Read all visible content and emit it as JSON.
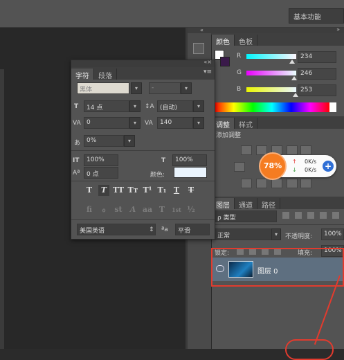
{
  "workspace": {
    "label": "基本功能"
  },
  "color_panel": {
    "tabs": [
      "颜色",
      "色板"
    ],
    "r_label": "R",
    "g_label": "G",
    "b_label": "B",
    "r_value": "234",
    "g_value": "246",
    "b_value": "253",
    "r_fraction": 0.918,
    "g_fraction": 0.965,
    "b_fraction": 0.992
  },
  "char_panel": {
    "tabs": [
      "字符",
      "段落"
    ],
    "font_family": "黑体",
    "font_style": "-",
    "font_size": "14 点",
    "leading": "(自动)",
    "kerning": "0",
    "tracking": "140",
    "tsume": "0%",
    "v_scale": "100%",
    "h_scale": "100%",
    "baseline": "0 点",
    "color_label": "颜色:",
    "color_value": "#eaf4fd",
    "type_buttons": [
      "T",
      "T",
      "TT",
      "Tт",
      "T¹",
      "T₁",
      "T",
      "T"
    ],
    "ot_buttons": [
      "fi",
      "ℴ",
      "st",
      "A",
      "aa",
      "T",
      "1st",
      "½"
    ],
    "language": "美国英语",
    "aa_label": "ªa",
    "aa_method": "平滑"
  },
  "adjust_panel": {
    "tabs": [
      "调整",
      "样式"
    ],
    "title": "添加调整",
    "widget_percent": "78%",
    "upload": "0K/s",
    "download": "0K/s"
  },
  "layers_panel": {
    "tabs": [
      "图层",
      "通道",
      "路径"
    ],
    "filter": "ρ 类型",
    "blend_mode": "正常",
    "opacity_label": "不透明度:",
    "opacity": "100%",
    "lock_label": "锁定:",
    "fill_label": "填充:",
    "fill": "100%",
    "layer_name": "图层 0"
  }
}
